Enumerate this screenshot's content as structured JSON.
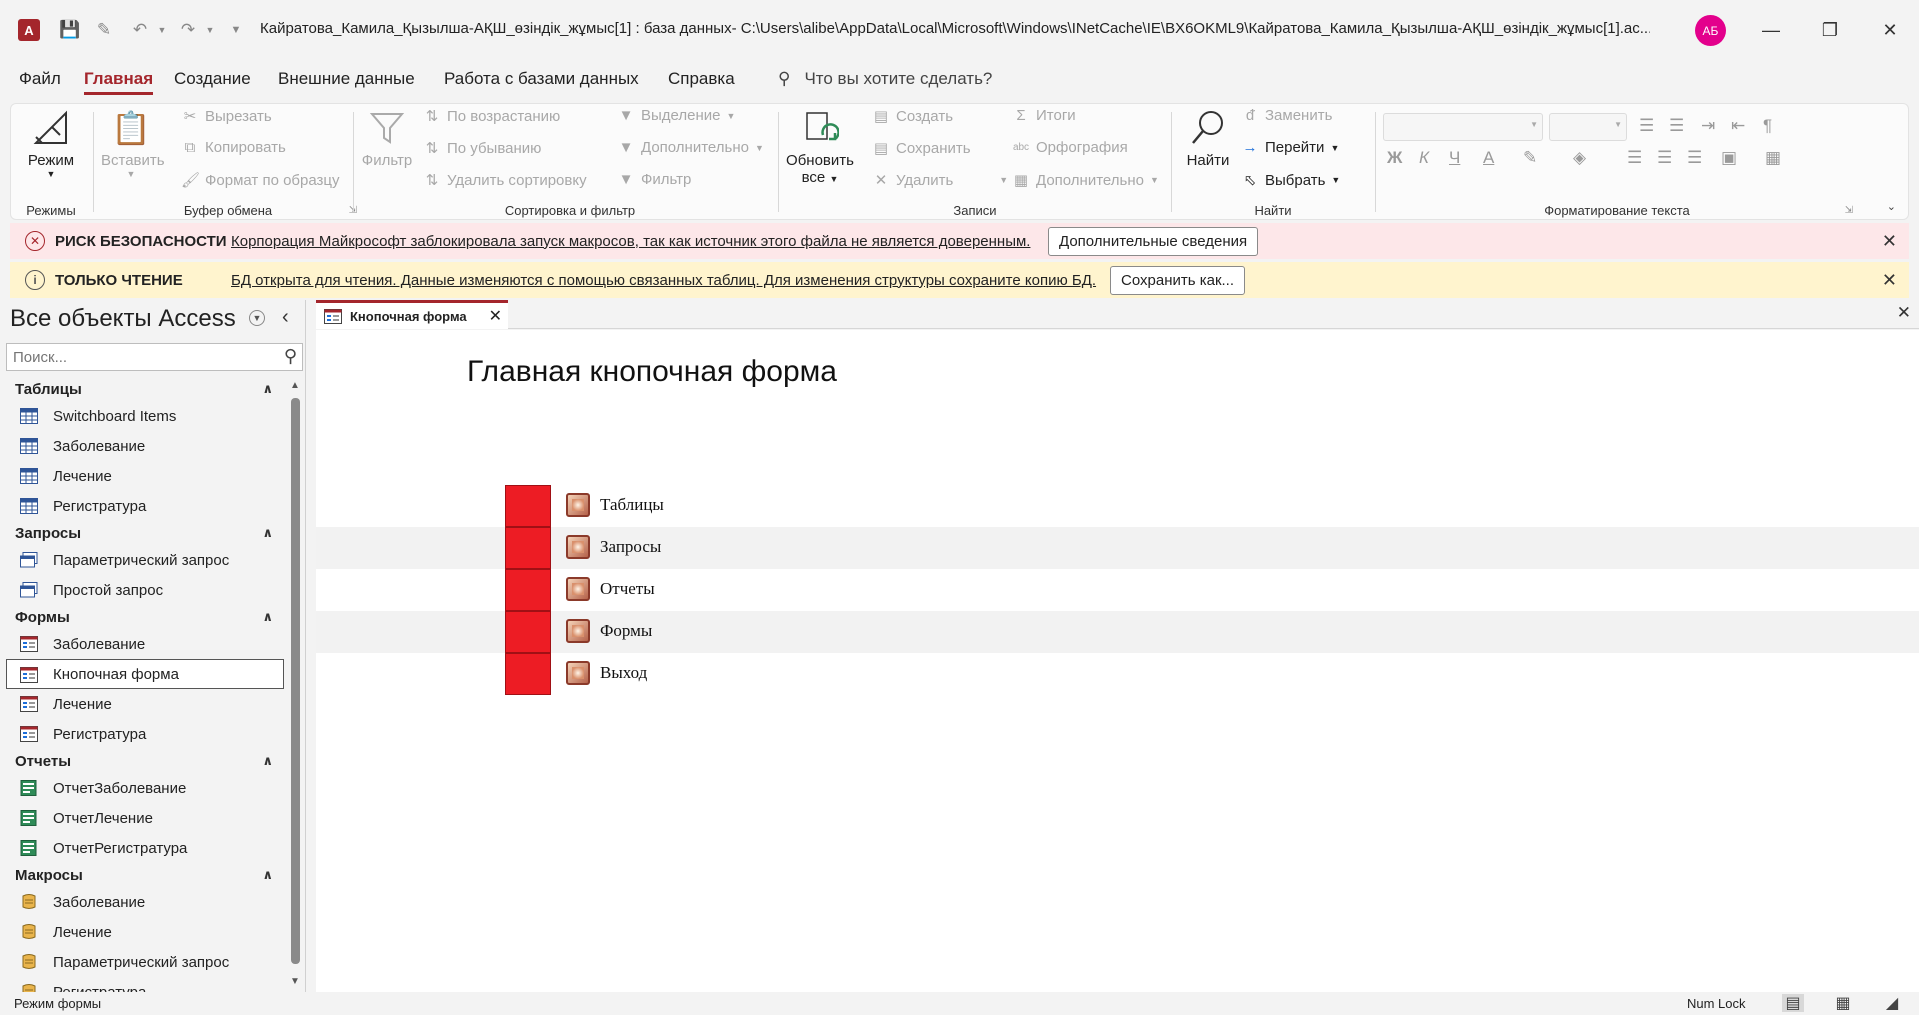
{
  "app": {
    "title": "Кайратова_Камила_Қызылша-АҚШ_өзіндік_жұмыс[1] : база данных- C:\\Users\\alibe\\AppData\\Local\\Microsoft\\Windows\\INetCache\\IE\\BX6OKML9\\Кайратова_Камила_Қызылша-АҚШ_өзіндік_жұмыс[1].ac...",
    "icon_letter": "A",
    "avatar_initials": "АБ"
  },
  "ribbon_tabs": [
    "Файл",
    "Главная",
    "Создание",
    "Внешние данные",
    "Работа с базами данных",
    "Справка"
  ],
  "tell_me": "Что вы хотите сделать?",
  "ribbon": {
    "modes": {
      "view_label": "Режим",
      "group": "Режимы"
    },
    "clipboard": {
      "paste": "Вставить",
      "cut": "Вырезать",
      "copy": "Копировать",
      "format_painter": "Формат по образцу",
      "group": "Буфер обмена"
    },
    "sort_filter": {
      "filter": "Фильтр",
      "ascending": "По возрастанию",
      "descending": "По убыванию",
      "remove_sort": "Удалить сортировку",
      "selection": "Выделение",
      "advanced": "Дополнительно",
      "toggle_filter": "Фильтр",
      "group": "Сортировка и фильтр"
    },
    "records": {
      "refresh_line1": "Обновить",
      "refresh_line2": "все",
      "new": "Создать",
      "save": "Сохранить",
      "delete": "Удалить",
      "totals": "Итоги",
      "spelling": "Орфография",
      "more": "Дополнительно",
      "group": "Записи"
    },
    "find": {
      "find": "Найти",
      "replace": "Заменить",
      "goto": "Перейти",
      "select": "Выбрать",
      "group": "Найти"
    },
    "text_formatting": {
      "bold": "Ж",
      "italic": "К",
      "underline": "Ч",
      "group": "Форматирование текста"
    }
  },
  "security_bar": {
    "title": "РИСК БЕЗОПАСНОСТИ",
    "message": "Корпорация Майкрософт заблокировала запуск макросов, так как источник этого файла не является доверенным.",
    "button": "Дополнительные сведения"
  },
  "readonly_bar": {
    "title": "ТОЛЬКО ЧТЕНИЕ",
    "message": "БД открыта для чтения. Данные изменяются с помощью связанных таблиц. Для изменения структуры сохраните копию БД.",
    "button": "Сохранить как..."
  },
  "nav": {
    "title": "Все объекты Access",
    "search_placeholder": "Поиск...",
    "groups": [
      {
        "name": "Таблицы",
        "type": "table",
        "items": [
          "Switchboard Items",
          "Заболевание",
          "Лечение",
          "Регистратура"
        ]
      },
      {
        "name": "Запросы",
        "type": "query",
        "items": [
          "Параметрический запрос",
          "Простой запрос"
        ]
      },
      {
        "name": "Формы",
        "type": "form",
        "items": [
          "Заболевание",
          "Кнопочная форма",
          "Лечение",
          "Регистратура"
        ]
      },
      {
        "name": "Отчеты",
        "type": "report",
        "items": [
          "ОтчетЗаболевание",
          "ОтчетЛечение",
          "ОтчетРегистратура"
        ]
      },
      {
        "name": "Макросы",
        "type": "macro",
        "items": [
          "Заболевание",
          "Лечение",
          "Параметрический запрос",
          "Регистратура"
        ]
      }
    ],
    "selected": "Кнопочная форма"
  },
  "document": {
    "tab_label": "Кнопочная форма",
    "form_title": "Главная кнопочная форма",
    "buttons": [
      "Таблицы",
      "Запросы",
      "Отчеты",
      "Формы",
      "Выход"
    ]
  },
  "status": {
    "mode": "Режим формы",
    "num_lock": "Num Lock"
  },
  "colors": {
    "accent": "#a4262c",
    "switchboard_red": "#ed1c24",
    "security_bg": "#fde7e9",
    "readonly_bg": "#fff4ce",
    "avatar": "#e3008c"
  }
}
